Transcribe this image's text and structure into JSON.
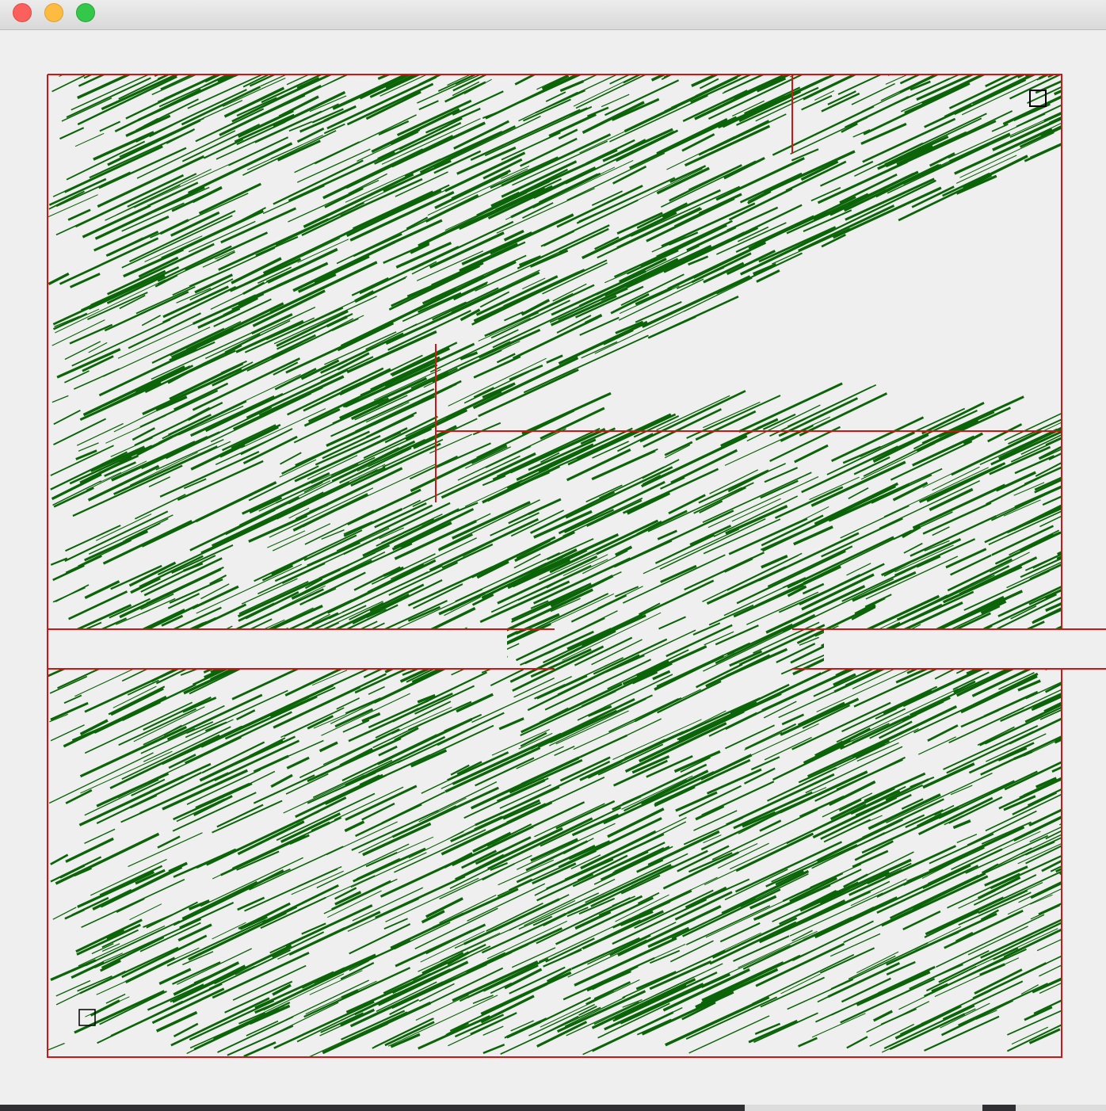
{
  "window": {
    "controls": [
      "close",
      "minimize",
      "maximize"
    ]
  },
  "colors": {
    "background": "#efefef",
    "obstacle_border": "#d01515",
    "path": "#0b6508",
    "marker": "#000000"
  },
  "markers": {
    "goal": "goal-square",
    "start": "start-square"
  }
}
